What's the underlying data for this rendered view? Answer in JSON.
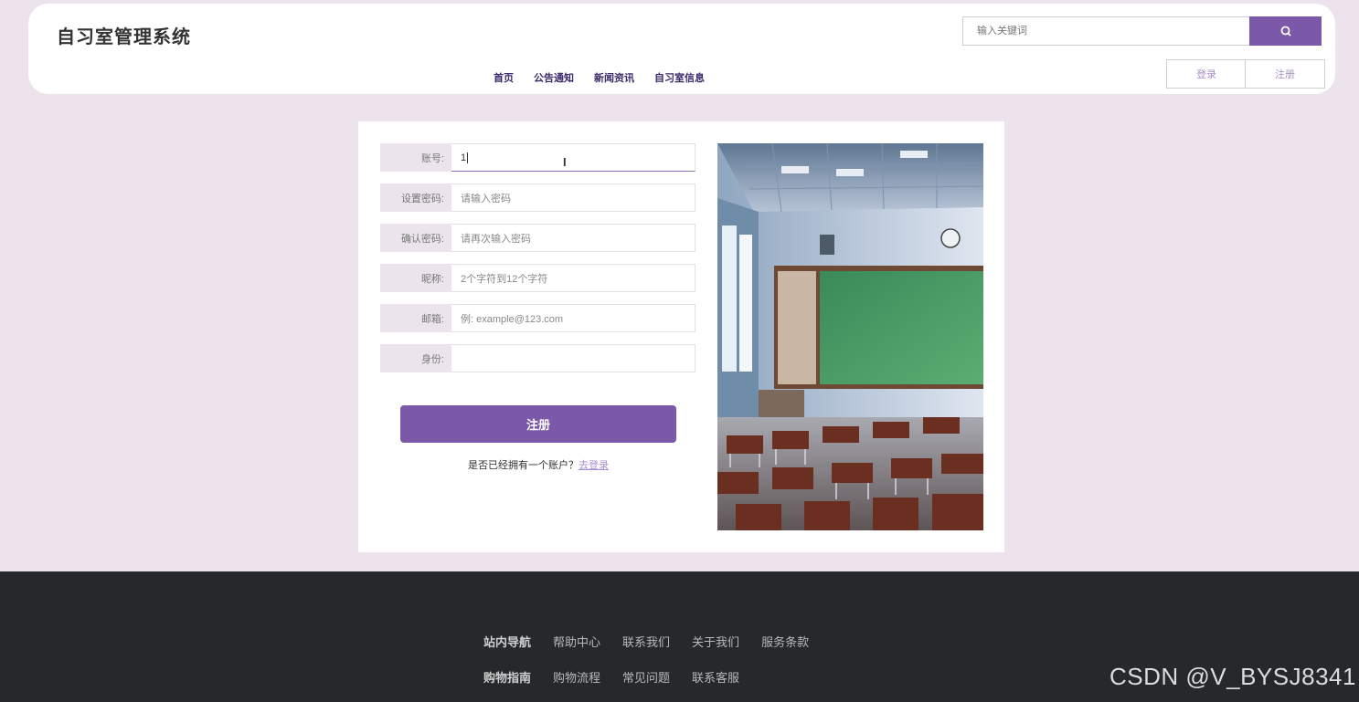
{
  "header": {
    "title": "自习室管理系统",
    "search_placeholder": "输入关键词",
    "search_icon": "search-icon",
    "nav": [
      "首页",
      "公告通知",
      "新闻资讯",
      "自习室信息"
    ],
    "login_label": "登录",
    "register_label": "注册"
  },
  "form": {
    "fields": [
      {
        "label": "账号:",
        "value": "1",
        "placeholder": ""
      },
      {
        "label": "设置密码:",
        "value": "",
        "placeholder": "请输入密码"
      },
      {
        "label": "确认密码:",
        "value": "",
        "placeholder": "请再次输入密码"
      },
      {
        "label": "昵称:",
        "value": "",
        "placeholder": "2个字符到12个字符"
      },
      {
        "label": "邮箱:",
        "value": "",
        "placeholder": "例: example@123.com"
      },
      {
        "label": "身份:",
        "value": "",
        "placeholder": ""
      }
    ],
    "submit_label": "注册",
    "hint_text": "是否已经拥有一个账户？",
    "login_link": "去登录"
  },
  "footer": {
    "row1": {
      "head": "站内导航",
      "items": [
        "帮助中心",
        "联系我们",
        "关于我们",
        "服务条款"
      ]
    },
    "row2": {
      "head": "购物指南",
      "items": [
        "购物流程",
        "常见问题",
        "联系客服"
      ]
    },
    "watermark": "CSDN @V_BYSJ8341"
  },
  "colors": {
    "accent": "#7b59a8",
    "background": "#ece3ec",
    "footer": "#25292b"
  }
}
